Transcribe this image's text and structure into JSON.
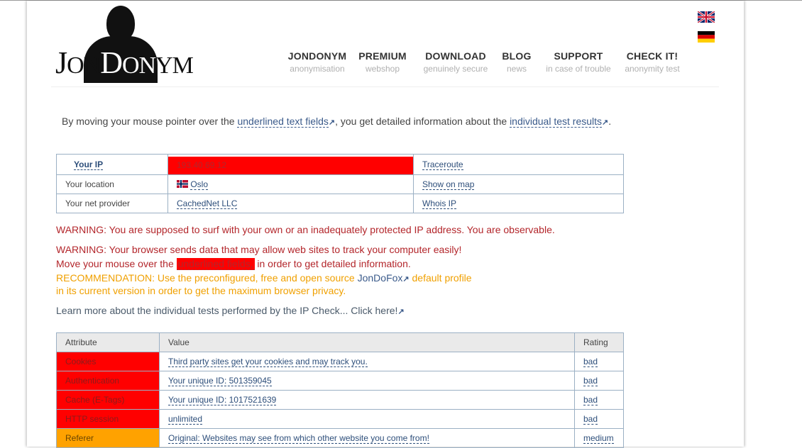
{
  "header": {
    "logo_text": "JonDonym",
    "nav": [
      {
        "title": "JONDONYM",
        "subtitle": "anonymisation"
      },
      {
        "title": "PREMIUM",
        "subtitle": "webshop"
      },
      {
        "title": "DOWNLOAD",
        "subtitle": "genuinely secure"
      },
      {
        "title": "BLOG",
        "subtitle": "news"
      },
      {
        "title": "SUPPORT",
        "subtitle": "in case of trouble"
      },
      {
        "title": "CHECK IT!",
        "subtitle": "anonymity test"
      }
    ],
    "languages": [
      "English",
      "Deutsch"
    ]
  },
  "intro": {
    "part1": "By moving your mouse pointer over the ",
    "link1": "underlined text fields",
    "part2": ", you get detailed information about the ",
    "link2": "individual test results",
    "part3": "."
  },
  "ip_table": {
    "rows": [
      {
        "label": "Your IP",
        "value": "193.40.69.12",
        "action": "Traceroute"
      },
      {
        "label": "Your location",
        "value": "Oslo",
        "action": "Show on map"
      },
      {
        "label": "Your net provider",
        "value": "CachedNet LLC",
        "action": "Whois IP"
      }
    ]
  },
  "warnings": {
    "ip_warning": "WARNING: You are supposed to surf with your own or an inadequately protected IP address. You are observable.",
    "browser_warning": "WARNING: Your browser sends data that may allow web sites to track your computer easily!",
    "move_part1": "Move your mouse over the ",
    "move_highlight": "underlined fields,",
    "move_part2": " in order to get detailed information.",
    "rec_part1": "RECOMMENDATION: Use the preconfigured, free and open source ",
    "rec_link": "JonDoFox",
    "rec_part2": " default profile",
    "rec_line2": "in its current version in order to get the maximum browser privacy.",
    "learn_more": "Learn more about the individual tests performed by the IP Check... Click here!"
  },
  "results": {
    "headers": [
      "Attribute",
      "Value",
      "Rating"
    ],
    "rows": [
      {
        "attribute": "Cookies",
        "value": "Third party sites get your cookies and may track you.",
        "rating": "bad",
        "color": "#ff0000"
      },
      {
        "attribute": "Authentication",
        "value": "Your unique ID: 501359045",
        "rating": "bad",
        "color": "#ff0000"
      },
      {
        "attribute": "Cache (E-Tags)",
        "value": "Your unique ID: 1017521639",
        "rating": "bad",
        "color": "#ff0000"
      },
      {
        "attribute": "HTTP session",
        "value": "unlimited",
        "rating": "bad",
        "color": "#ff0000"
      },
      {
        "attribute": "Referer",
        "value": "Original: Websites may see from which other website you come from!",
        "rating": "medium",
        "color": "#ffa200"
      }
    ]
  }
}
